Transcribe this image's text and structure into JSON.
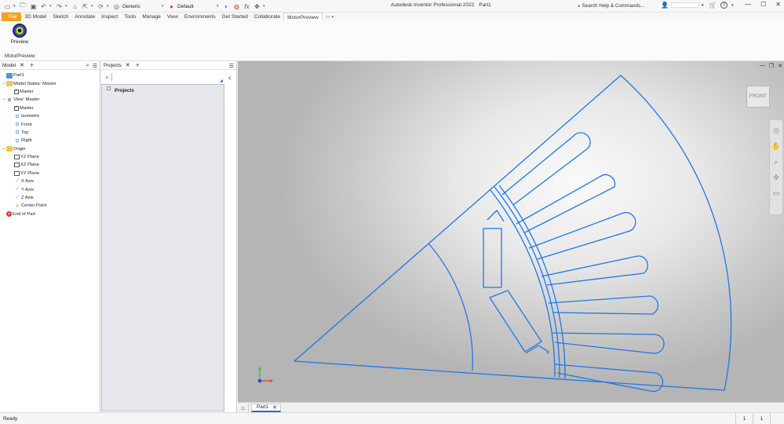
{
  "titlebar": {
    "app_name": "Autodesk Inventor Professional 2022",
    "document_name": "Part1",
    "search_placeholder": "Search Help & Commands...",
    "material_select": "Generic",
    "appearance_select": "Default",
    "fx_label": "fx",
    "help_label": "?"
  },
  "ribbon": {
    "tabs": [
      "File",
      "3D Model",
      "Sketch",
      "Annotate",
      "Inspect",
      "Tools",
      "Manage",
      "View",
      "Environments",
      "Get Started",
      "Collaborate",
      "MotorPreview"
    ],
    "active_tab": "MotorPreview",
    "panel_button_label": "Preview",
    "panel_label": "MotorPreview"
  },
  "model_browser": {
    "tab_label": "Model",
    "items": [
      {
        "label": "Part1",
        "icon": "part-icon",
        "level": 0,
        "expander": ""
      },
      {
        "label": "Model States: Master",
        "icon": "folder-icon",
        "level": 0,
        "expander": "−"
      },
      {
        "label": "Master",
        "icon": "model-state-icon",
        "level": 1,
        "expander": ""
      },
      {
        "label": "View: Master",
        "icon": "view-icon",
        "level": 0,
        "expander": "−"
      },
      {
        "label": "Master",
        "icon": "view-state-icon",
        "level": 1,
        "expander": ""
      },
      {
        "label": "Isometric",
        "icon": "camera-view-icon",
        "level": 1,
        "expander": ""
      },
      {
        "label": "Front",
        "icon": "camera-view-icon",
        "level": 1,
        "expander": ""
      },
      {
        "label": "Top",
        "icon": "camera-view-icon",
        "level": 1,
        "expander": ""
      },
      {
        "label": "Right",
        "icon": "camera-view-icon",
        "level": 1,
        "expander": ""
      },
      {
        "label": "Origin",
        "icon": "folder-icon",
        "level": 0,
        "expander": "−"
      },
      {
        "label": "YZ Plane",
        "icon": "plane-icon",
        "level": 1,
        "expander": ""
      },
      {
        "label": "XZ Plane",
        "icon": "plane-icon",
        "level": 1,
        "expander": ""
      },
      {
        "label": "XY Plane",
        "icon": "plane-icon",
        "level": 1,
        "expander": ""
      },
      {
        "label": "X Axis",
        "icon": "axis-icon",
        "level": 1,
        "expander": ""
      },
      {
        "label": "Y Axis",
        "icon": "axis-icon",
        "level": 1,
        "expander": ""
      },
      {
        "label": "Z Axis",
        "icon": "axis-icon",
        "level": 1,
        "expander": ""
      },
      {
        "label": "Center Point",
        "icon": "point-icon",
        "level": 1,
        "expander": ""
      },
      {
        "label": "End of Part",
        "icon": "end-of-part-icon",
        "level": 0,
        "expander": ""
      }
    ]
  },
  "projects_panel": {
    "tab_label": "Projects",
    "list_header": "Projects"
  },
  "viewport": {
    "viewcube_label": "FRONT",
    "sketch_color": "#1e78e6",
    "axis_colors": {
      "x": "#e03a3a",
      "y": "#2fbf4a",
      "z": "#2d3fd6"
    }
  },
  "document_tabs": [
    {
      "label": "Part1"
    }
  ],
  "statusbar": {
    "status": "Ready",
    "count1": "1",
    "count2": "1"
  }
}
